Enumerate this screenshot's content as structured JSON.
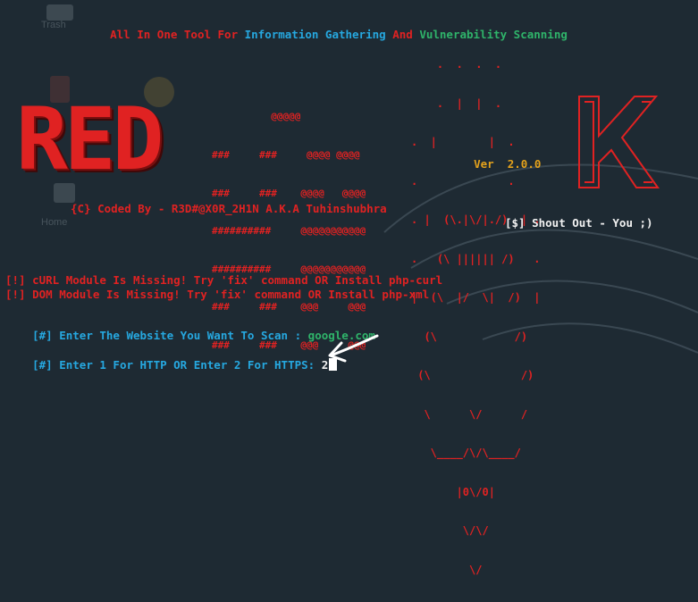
{
  "colors": {
    "background": "#1e2a33",
    "red": "#e02222",
    "cyan": "#26a8e0",
    "green": "#2fb46a",
    "orange": "#e4a21c",
    "white": "#f2f2f2",
    "arrow": "#ffffff"
  },
  "header": {
    "part1": "All In One Tool For ",
    "part2": "Information Gathering ",
    "part3": "And ",
    "part4": "Vulnerability Scanning"
  },
  "logo": {
    "red_big": "RED",
    "k_big": "K",
    "hawk_lines": [
      "    .  .  .  .",
      "    .  |  |  .",
      ".  |        |  .",
      ".              .",
      ". |  (\\.|\\/|./)  | .",
      ".   (\\ |||||| /)   .",
      "|  (\\  |/  \\|  /)  |",
      "  (\\            /)",
      " (\\              /)",
      "  \\      \\/      /",
      "   \\____/\\/\\____/",
      "       |0\\/0|",
      "        \\/\\/",
      "         \\/"
    ],
    "at_block": [
      "          @@@@@",
      "###     ###     @@@@ @@@@",
      "###     ###    @@@@   @@@@",
      "##########     @@@@@@@@@@@",
      "##########     @@@@@@@@@@@",
      "###     ###    @@@     @@@",
      "###     ###    @@@     @@@"
    ],
    "version_label": "Ver",
    "version_value": "2.0.0"
  },
  "credits": "{C} Coded By - R3D#@X0R_2H1N A.K.A Tuhinshubhra",
  "shout_out": "[$] Shout Out - You ;)",
  "warnings": [
    "[!] cURL Module Is Missing! Try 'fix' command OR Install php-curl",
    "[!] DOM Module Is Missing! Try 'fix' command OR Install php-xml"
  ],
  "prompt_site": {
    "label": "[#] Enter The Website You Want To Scan : ",
    "value": "google.com"
  },
  "prompt_protocol": {
    "label": "[#] Enter 1 For HTTP OR Enter 2 For HTTPS: ",
    "value": "2"
  },
  "desktop_labels": {
    "trash": "Trash",
    "home": "Home"
  }
}
